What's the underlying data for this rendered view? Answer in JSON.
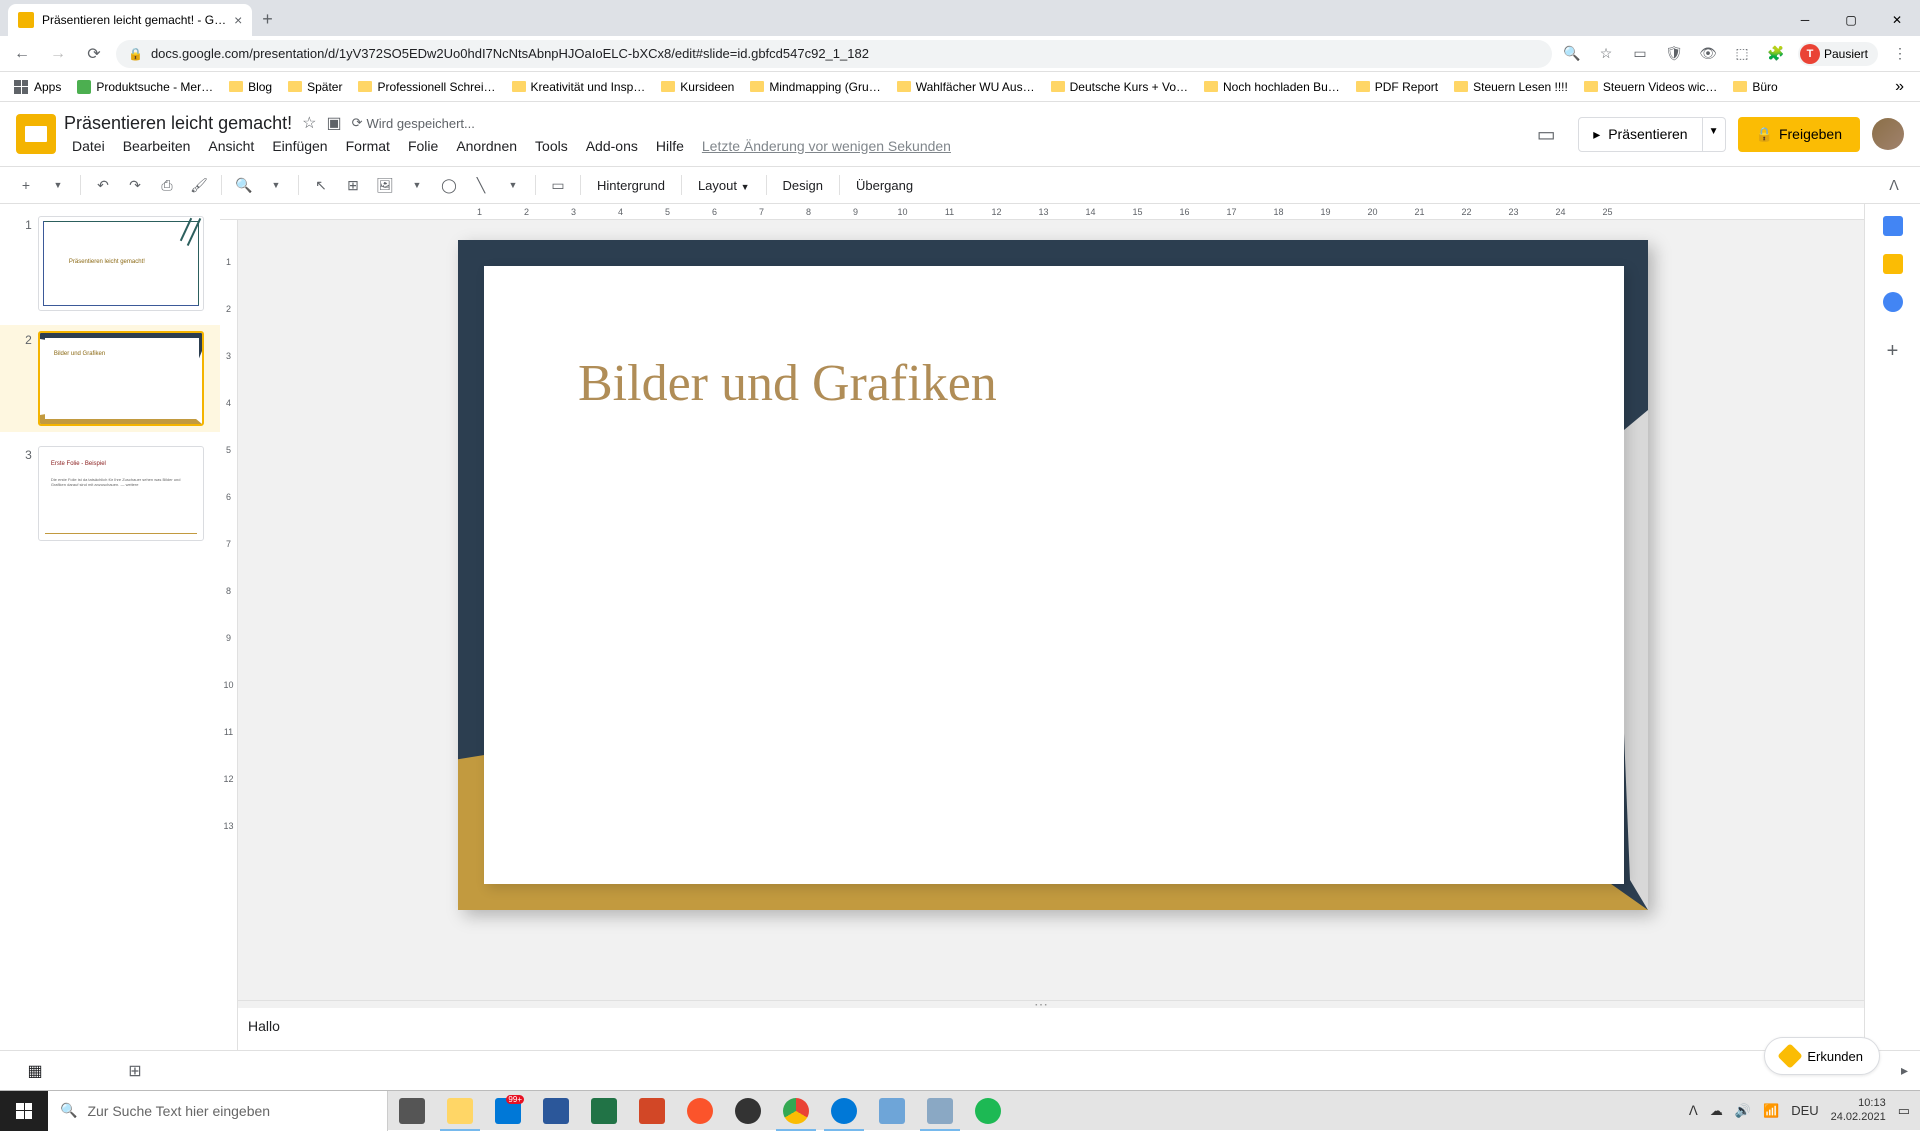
{
  "browser": {
    "tab_title": "Präsentieren leicht gemacht! - G…",
    "url": "docs.google.com/presentation/d/1yV372SO5EDw2Uo0hdI7NcNtsAbnpHJOaIoELC-bXCx8/edit#slide=id.gbfcd547c92_1_182",
    "profile_status": "Pausiert",
    "apps_label": "Apps",
    "bookmarks": [
      "Produktsuche - Mer…",
      "Blog",
      "Später",
      "Professionell Schrei…",
      "Kreativität und Insp…",
      "Kursideen",
      "Mindmapping  (Gru…",
      "Wahlfächer WU Aus…",
      "Deutsche Kurs + Vo…",
      "Noch hochladen Bu…",
      "PDF Report",
      "Steuern Lesen !!!!",
      "Steuern Videos wic…",
      "Büro"
    ]
  },
  "doc": {
    "title": "Präsentieren leicht gemacht!",
    "save_status": "Wird gespeichert...",
    "last_edit": "Letzte Änderung vor wenigen Sekunden"
  },
  "menus": [
    "Datei",
    "Bearbeiten",
    "Ansicht",
    "Einfügen",
    "Format",
    "Folie",
    "Anordnen",
    "Tools",
    "Add-ons",
    "Hilfe"
  ],
  "header_buttons": {
    "present": "Präsentieren",
    "share": "Freigeben"
  },
  "toolbar": {
    "background": "Hintergrund",
    "layout": "Layout",
    "design": "Design",
    "transition": "Übergang"
  },
  "ruler_h": [
    "1",
    "2",
    "3",
    "4",
    "5",
    "6",
    "7",
    "8",
    "9",
    "10",
    "11",
    "12",
    "13",
    "14",
    "15",
    "16",
    "17",
    "18",
    "19",
    "20",
    "21",
    "22",
    "23",
    "24",
    "25"
  ],
  "ruler_v": [
    "1",
    "2",
    "3",
    "4",
    "5",
    "6",
    "7",
    "8",
    "9",
    "10",
    "11",
    "12",
    "13"
  ],
  "slides": [
    {
      "num": "1",
      "title": "Präsentieren leicht gemacht!"
    },
    {
      "num": "2",
      "title": "Bilder und Grafiken"
    },
    {
      "num": "3",
      "title": "Erste Folie - Beispiel",
      "body": "Die erste Folie ist da tatsächlich für Ihre Zuschauer sehen was\nBilder und Grafiken darauf sind mit anzuschauen.\n— weitere"
    }
  ],
  "current_slide_title": "Bilder und Grafiken",
  "notes": "Hallo",
  "explore": "Erkunden",
  "taskbar": {
    "search_placeholder": "Zur Suche Text hier eingeben",
    "lang": "DEU",
    "time": "10:13",
    "date": "24.02.2021",
    "notification_badge": "99+"
  }
}
